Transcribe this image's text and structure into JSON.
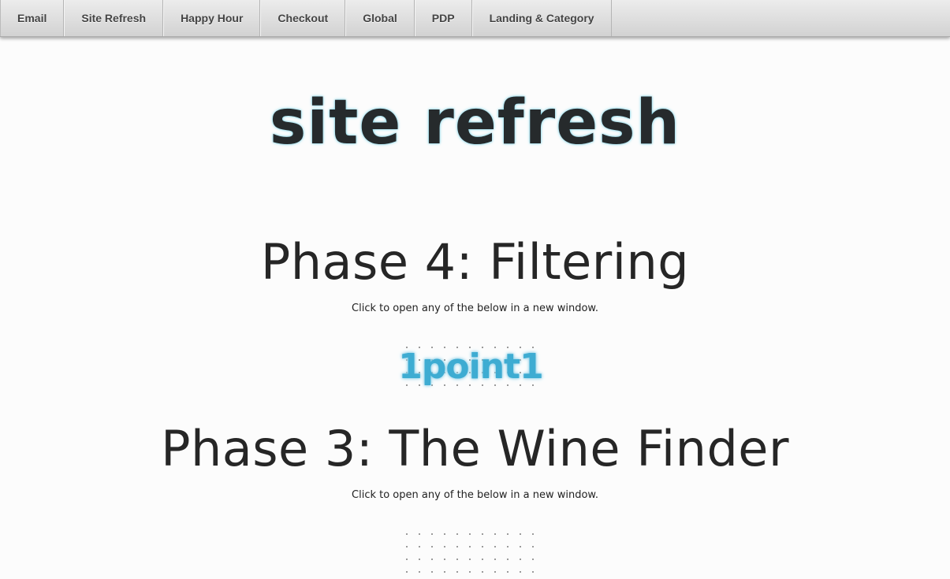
{
  "nav": {
    "items": [
      {
        "label": "Email"
      },
      {
        "label": "Site Refresh"
      },
      {
        "label": "Happy Hour"
      },
      {
        "label": "Checkout"
      },
      {
        "label": "Global"
      },
      {
        "label": "PDP"
      },
      {
        "label": "Landing & Category"
      }
    ]
  },
  "page": {
    "title": "site refresh"
  },
  "phases": [
    {
      "heading": "Phase 4: Filtering",
      "subtitle": "Click to open any of the below in a new window.",
      "logo_text": "1point1"
    },
    {
      "heading": "Phase 3: The Wine Finder",
      "subtitle": "Click to open any of the below in a new window."
    }
  ],
  "colors": {
    "accent": "#3eacd2",
    "heading": "#262626"
  }
}
